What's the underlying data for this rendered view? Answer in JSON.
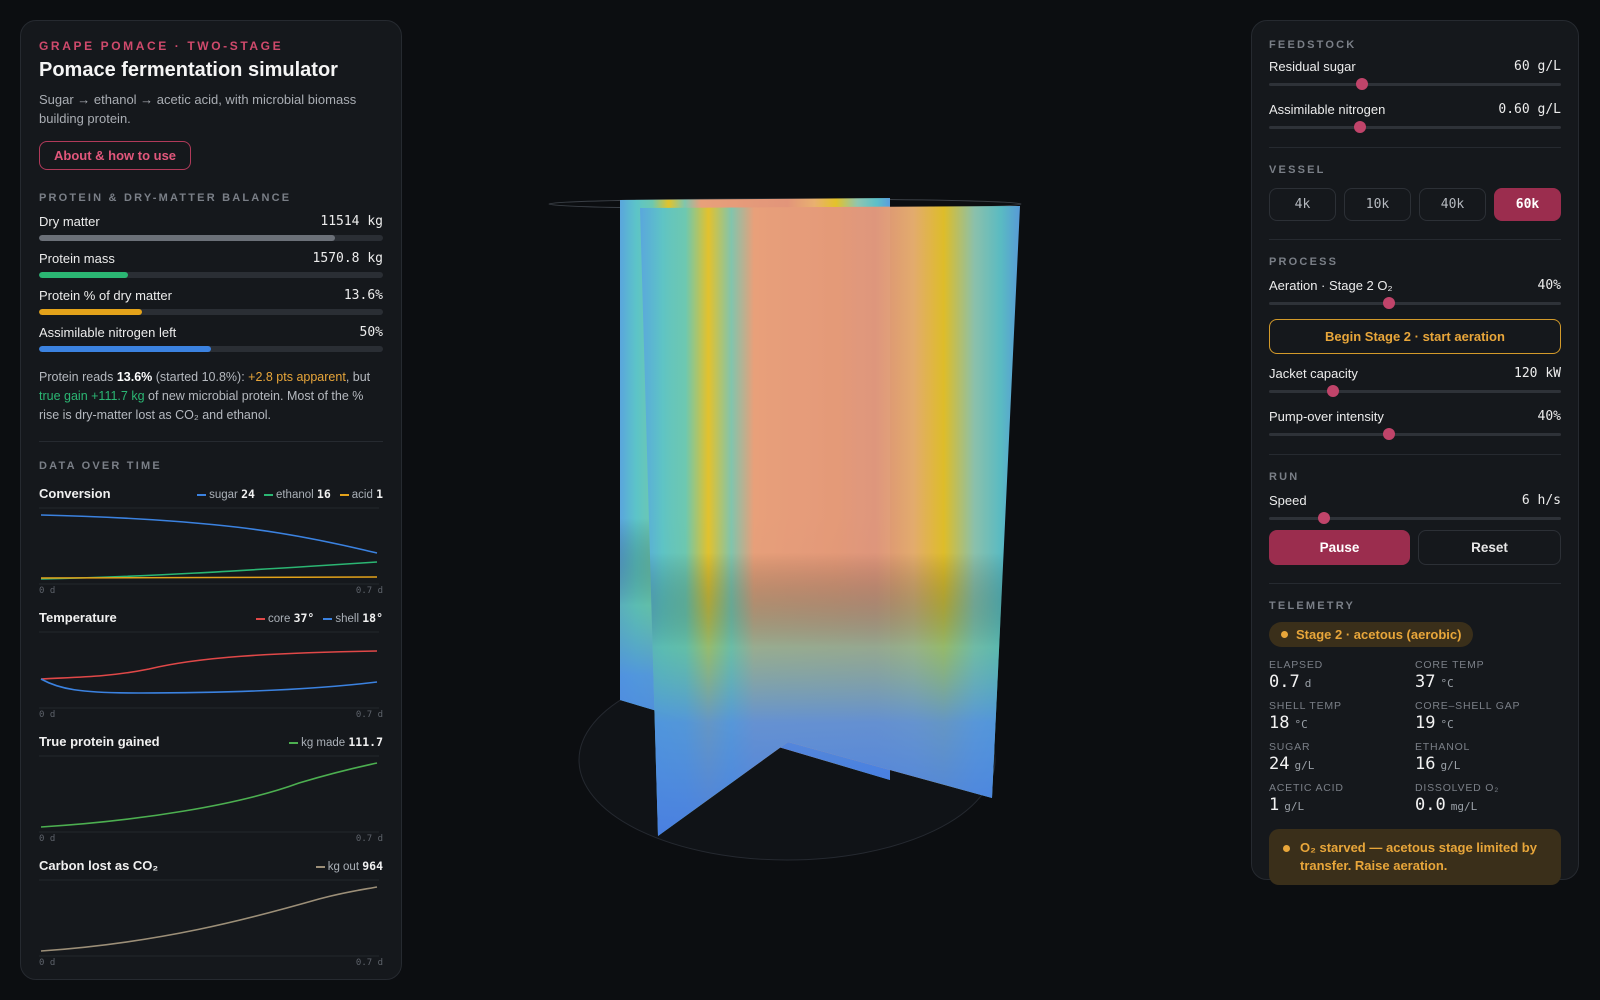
{
  "header": {
    "eyebrow": "GRAPE POMACE · TWO-STAGE",
    "title": "Pomace fermentation simulator",
    "subtitle": "Sugar → ethanol → acetic acid, with microbial biomass building protein.",
    "about_label": "About & how to use"
  },
  "balance": {
    "section": "PROTEIN & DRY-MATTER BALANCE",
    "metrics": [
      {
        "label": "Dry matter",
        "value": "11514 kg",
        "fraction": 0.86,
        "color": "#6b7078"
      },
      {
        "label": "Protein mass",
        "value": "1570.8 kg",
        "fraction": 0.26,
        "color": "#2bb673"
      },
      {
        "label": "Protein % of dry matter",
        "value": "13.6%",
        "fraction": 0.3,
        "color": "#e3a21a"
      },
      {
        "label": "Assimilable nitrogen left",
        "value": "50%",
        "fraction": 0.5,
        "color": "#3b82e0"
      }
    ],
    "note": {
      "p1": "Protein reads ",
      "pct": "13.6%",
      "p2": " (started 10.8%): ",
      "apparent": "+2.8 pts apparent",
      "p3": ", but ",
      "gain": "true gain +111.7 kg",
      "p4": " of new microbial protein. Most of the % rise is dry-matter lost as CO₂ and ethanol."
    }
  },
  "data_over_time": {
    "section": "DATA OVER TIME",
    "axis_start": "0 d",
    "axis_end": "0.7 d",
    "charts": [
      {
        "title": "Conversion",
        "legend": [
          {
            "name": "sugar",
            "value": "24",
            "color": "#3b82e0"
          },
          {
            "name": "ethanol",
            "value": "16",
            "color": "#2bb673"
          },
          {
            "name": "acid",
            "value": "1",
            "color": "#e3a21a"
          }
        ]
      },
      {
        "title": "Temperature",
        "legend": [
          {
            "name": "core",
            "value": "37°",
            "color": "#e04848"
          },
          {
            "name": "shell",
            "value": "18°",
            "color": "#3b82e0"
          }
        ]
      },
      {
        "title": "True protein gained",
        "legend": [
          {
            "name": "kg made",
            "value": "111.7",
            "color": "#4caf50"
          }
        ]
      },
      {
        "title": "Carbon lost as CO₂",
        "legend": [
          {
            "name": "kg out",
            "value": "964",
            "color": "#9c8f78"
          }
        ]
      }
    ]
  },
  "feedstock": {
    "section": "FEEDSTOCK",
    "residual_sugar": {
      "label": "Residual sugar",
      "value": "60 g/L",
      "fraction": 0.32
    },
    "assimilable_nitrogen": {
      "label": "Assimilable nitrogen",
      "value": "0.60 g/L",
      "fraction": 0.31
    }
  },
  "vessel": {
    "section": "VESSEL",
    "options": [
      "4k",
      "10k",
      "40k",
      "60k"
    ],
    "selected": "60k"
  },
  "process": {
    "section": "PROCESS",
    "aeration": {
      "label": "Aeration · Stage 2 O₂",
      "value": "40%",
      "fraction": 0.41
    },
    "stage_button": "Begin Stage 2 · start aeration",
    "jacket": {
      "label": "Jacket capacity",
      "value": "120 kW",
      "fraction": 0.22
    },
    "pumpover": {
      "label": "Pump-over intensity",
      "value": "40%",
      "fraction": 0.41
    }
  },
  "run": {
    "section": "RUN",
    "speed": {
      "label": "Speed",
      "value": "6 h/s",
      "fraction": 0.19
    },
    "pause_label": "Pause",
    "reset_label": "Reset"
  },
  "telemetry": {
    "section": "TELEMETRY",
    "stage": "Stage 2 · acetous (aerobic)",
    "items": [
      {
        "label": "ELAPSED",
        "value": "0.7",
        "unit": "d"
      },
      {
        "label": "CORE TEMP",
        "value": "37",
        "unit": "°C"
      },
      {
        "label": "SHELL TEMP",
        "value": "18",
        "unit": "°C"
      },
      {
        "label": "CORE–SHELL GAP",
        "value": "19",
        "unit": "°C"
      },
      {
        "label": "SUGAR",
        "value": "24",
        "unit": "g/L"
      },
      {
        "label": "ETHANOL",
        "value": "16",
        "unit": "g/L"
      },
      {
        "label": "ACETIC ACID",
        "value": "1",
        "unit": "g/L"
      },
      {
        "label": "DISSOLVED O₂",
        "value": "0.0",
        "unit": "mg/L"
      }
    ],
    "warning": "O₂ starved — acetous stage limited by transfer. Raise aeration."
  },
  "colors": {
    "accent": "#c0446a",
    "warn": "#e8a63a",
    "panel": "#15181c",
    "bg": "#0c0e11"
  }
}
